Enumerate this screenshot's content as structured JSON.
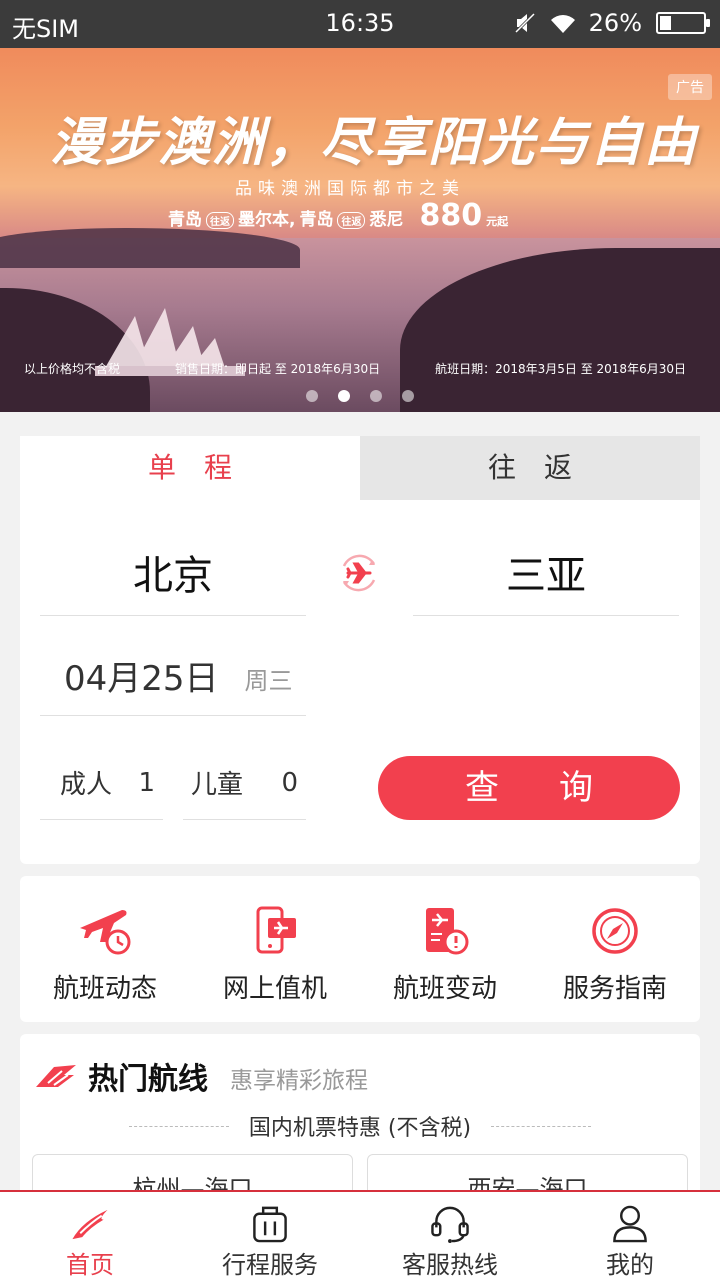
{
  "status_bar": {
    "carrier": "无SIM",
    "time": "16:35",
    "battery_text": "26%",
    "battery_level": 0.26
  },
  "banner": {
    "title": "漫步澳洲，尽享阳光与自由",
    "subtitle": "品味澳洲国际都市之美",
    "route_from_1": "青岛",
    "tag_1": "往返",
    "route_to_1": "墨尔本,",
    "route_from_2": "青岛",
    "tag_2": "往返",
    "route_to_2": "悉尼",
    "price": "880",
    "price_unit": "元起",
    "ad_label": "广告",
    "footnote_tax": "以上价格均不含税",
    "footnote_sale": "销售日期：即日起 至 2018年6月30日",
    "footnote_flight": "航班日期：2018年3月5日 至 2018年6月30日",
    "slide_count": 4,
    "active_slide": 2
  },
  "booking": {
    "tabs": [
      {
        "label": "单程",
        "active": true
      },
      {
        "label": "往返",
        "active": false
      }
    ],
    "from_city": "北京",
    "to_city": "三亚",
    "date": "04月25日",
    "weekday": "周三",
    "adult_label": "成人",
    "adult_count": "1",
    "child_label": "儿童",
    "child_count": "0",
    "search_label": "查询"
  },
  "services": [
    {
      "label": "航班动态",
      "icon": "flight-status-icon"
    },
    {
      "label": "网上值机",
      "icon": "online-checkin-icon"
    },
    {
      "label": "航班变动",
      "icon": "flight-change-icon"
    },
    {
      "label": "服务指南",
      "icon": "compass-icon"
    }
  ],
  "hot_routes": {
    "title": "热门航线",
    "subtitle": "惠享精彩旅程",
    "section": "国内机票特惠 (不含税)",
    "routes": [
      "杭州—海口",
      "西安—海口"
    ]
  },
  "bottom_nav": [
    {
      "label": "首页",
      "icon": "home-logo-icon",
      "active": true
    },
    {
      "label": "行程服务",
      "icon": "luggage-icon",
      "active": false
    },
    {
      "label": "客服热线",
      "icon": "headset-icon",
      "active": false
    },
    {
      "label": "我的",
      "icon": "person-icon",
      "active": false
    }
  ],
  "colors": {
    "accent": "#f2404e",
    "status_bar": "#3b3b3b",
    "background": "#f2f2f2"
  }
}
